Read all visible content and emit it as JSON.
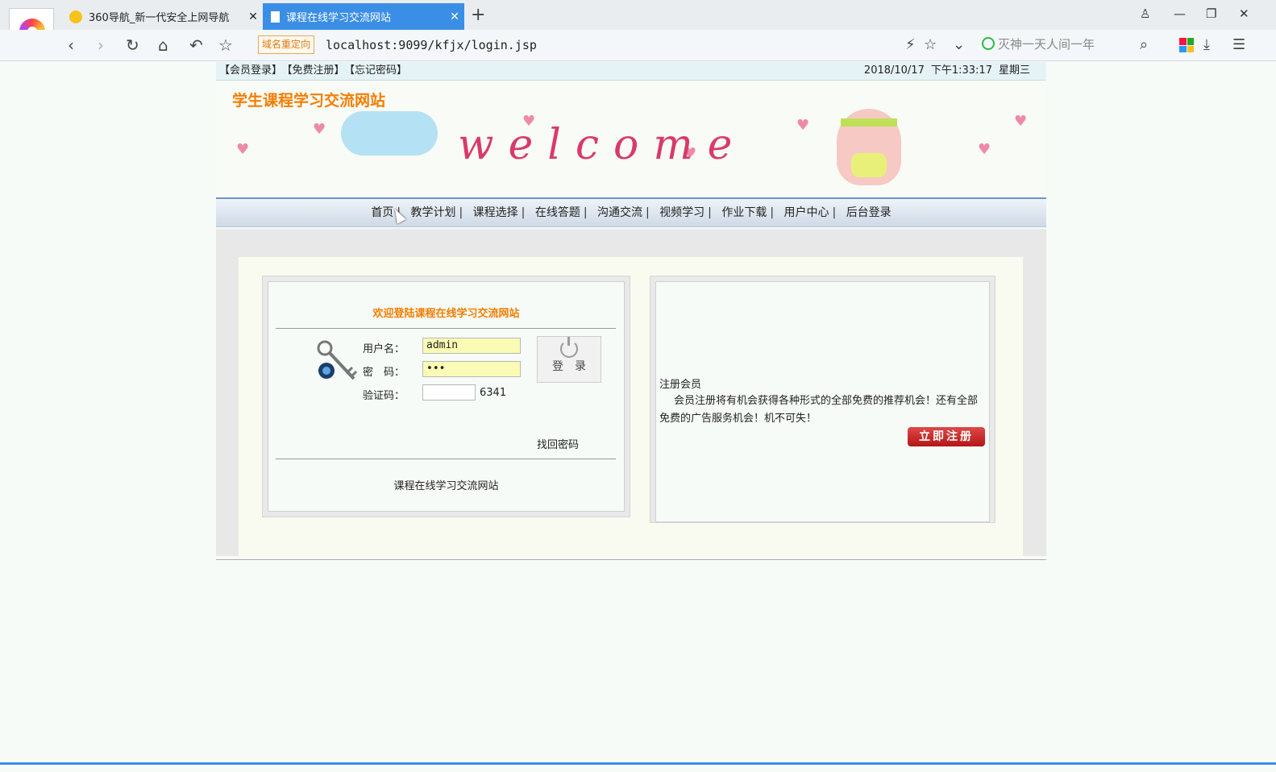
{
  "browser": {
    "tabs": [
      {
        "label": "360导航_新一代安全上网导航",
        "active": false
      },
      {
        "label": "课程在线学习交流网站",
        "active": true
      }
    ],
    "new_tab": "+",
    "redirect_badge": "域名重定向",
    "url": "localhost:9099/kfjx/login.jsp",
    "search_text": "灭神一天人间一年"
  },
  "page": {
    "top_links": [
      "【会员登录】",
      "【免费注册】",
      "【忘记密码】"
    ],
    "date": "2018/10/17",
    "time": "下午1:33:17",
    "weekday": "星期三",
    "site_title": "学生课程学习交流网站",
    "banner_text": "welcome",
    "nav": [
      "首页",
      "教学计划",
      "课程选择",
      "在线答题",
      "沟通交流",
      "视频学习",
      "作业下载",
      "用户中心",
      "后台登录"
    ],
    "nav_separator": "|"
  },
  "login": {
    "welcome": "欢迎登陆课程在线学习交流网站",
    "username_label": "用户名：",
    "username_value": "admin",
    "password_label": "密　码：",
    "password_value": "•••",
    "captcha_label": "验证码：",
    "captcha_code": "6341",
    "login_button": "登　录",
    "forgot_link": "找回密码",
    "footer": "课程在线学习交流网站"
  },
  "register": {
    "title": "注册会员",
    "text": "会员注册将有机会获得各种形式的全部免费的推荐机会！还有全部免费的广告服务机会！机不可失！",
    "button": "立即注册"
  },
  "colors": {
    "accent_orange": "#f57d00",
    "tab_blue": "#3a8ee6",
    "register_red": "#c21e1e"
  }
}
